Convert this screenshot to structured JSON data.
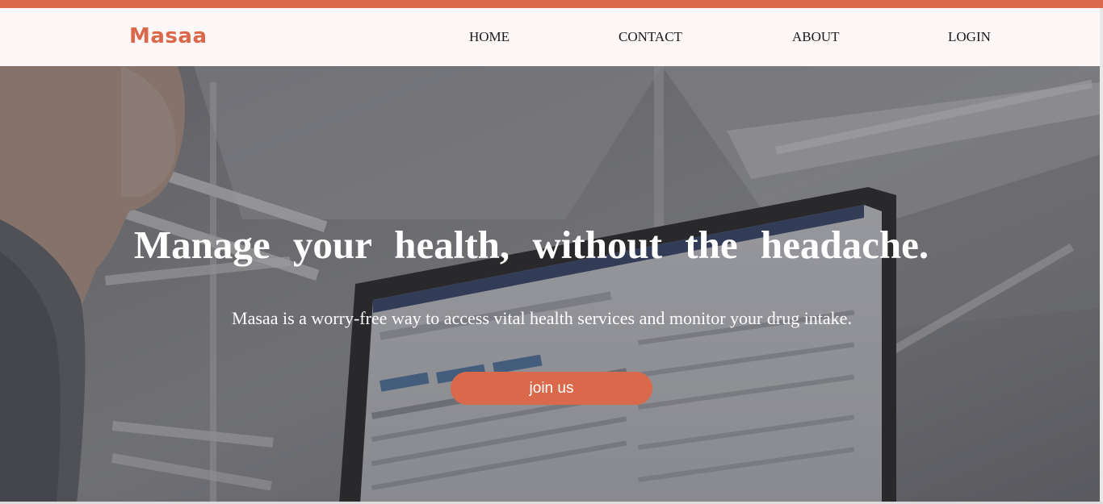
{
  "brand": {
    "name": "Masaa"
  },
  "nav": {
    "home": "HOME",
    "contact": "CONTACT",
    "about": "ABOUT",
    "login": "LOGIN"
  },
  "hero": {
    "title": "Manage your health, without the headache.",
    "subtitle": "Masaa is a worry-free way to access vital health services and monitor your drug intake.",
    "cta_label": "join us"
  },
  "colors": {
    "accent": "#d9694a",
    "nav_background": "#fdf7f7",
    "hero_text": "#ffffff"
  }
}
